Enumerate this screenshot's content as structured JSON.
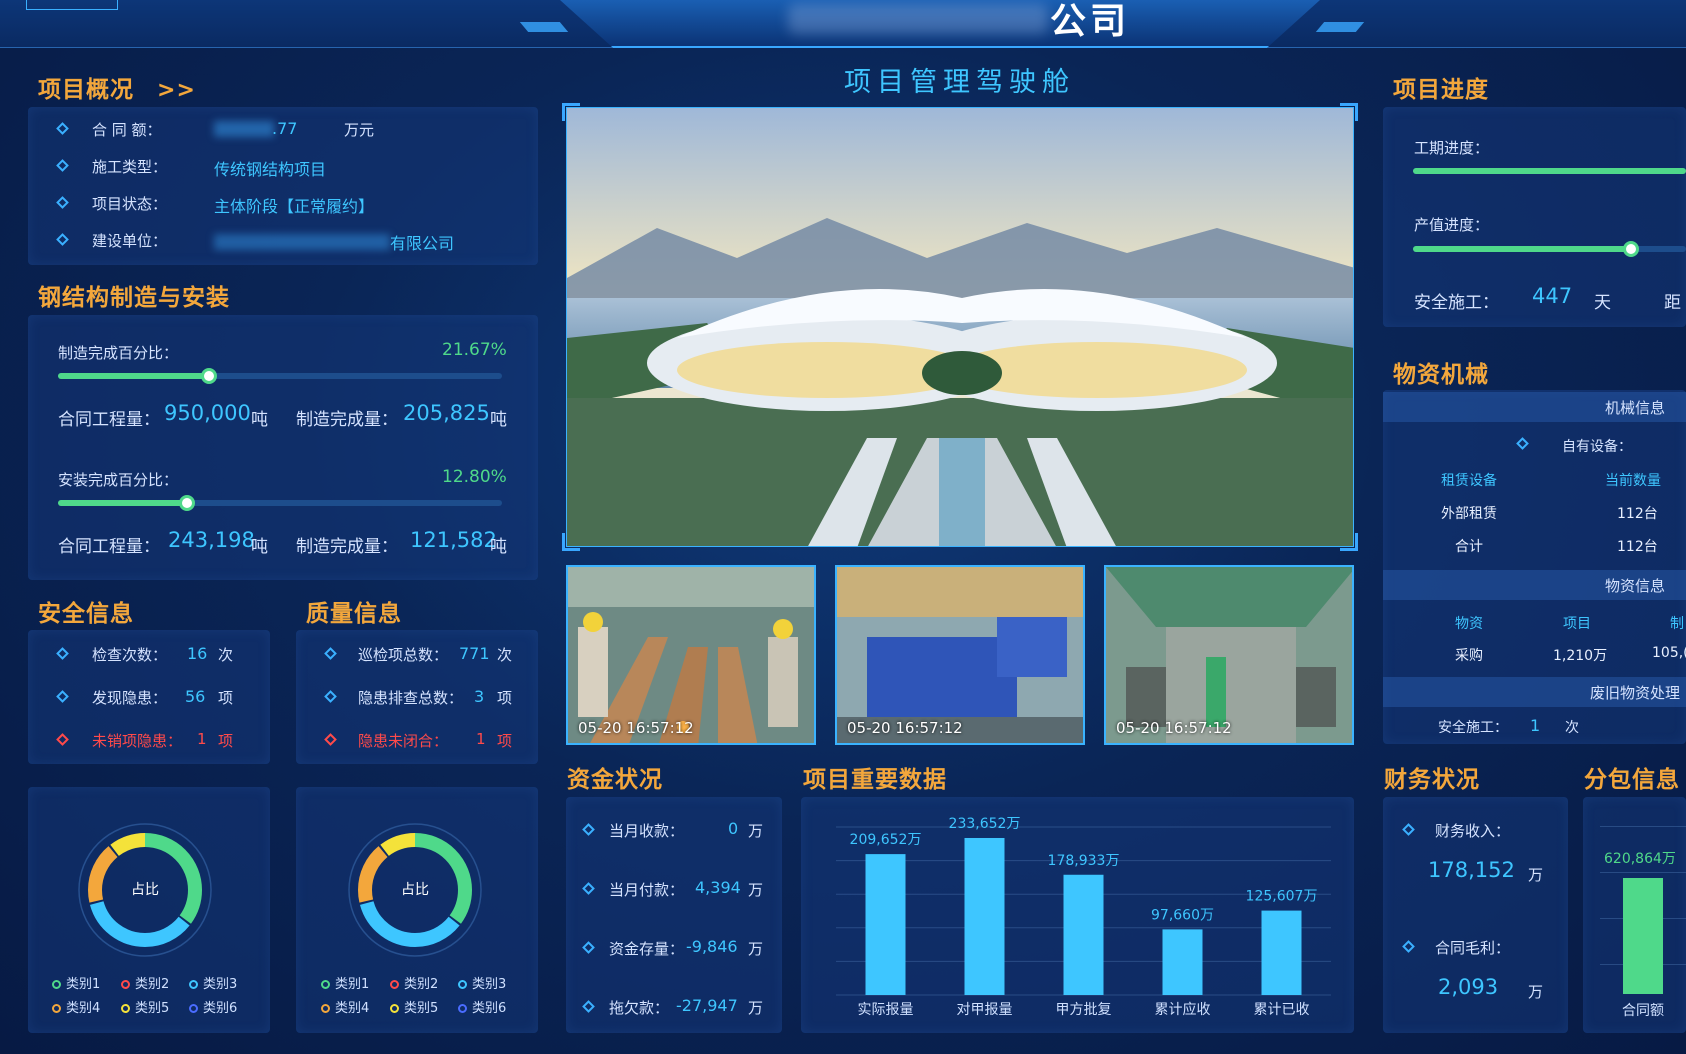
{
  "header": {
    "main_title": "公司",
    "subtitle": "项目管理驾驶舱"
  },
  "overview": {
    "title": "项目概况",
    "arrow": ">>",
    "rows": [
      {
        "label": "合 同 额：",
        "value": ".77",
        "unit": "万元"
      },
      {
        "label": "施工类型：",
        "value": "传统钢结构项目"
      },
      {
        "label": "项目状态：",
        "value": "主体阶段【正常履约】"
      },
      {
        "label": "建设单位：",
        "value": "有限公司"
      }
    ]
  },
  "steel": {
    "title": "钢结构制造与安装",
    "mfg_label": "制造完成百分比：",
    "mfg_pct": "21.67%",
    "mfg_fraction": 0.3412,
    "mfg_contract_label": "合同工程量：",
    "mfg_contract_value": "950,000",
    "mfg_done_label": "制造完成量：",
    "mfg_done_value": "205,825",
    "install_label": "安装完成百分比：",
    "install_pct": "12.80%",
    "install_fraction": 0.2915,
    "install_contract_label": "合同工程量：",
    "install_contract_value": "243,198",
    "install_done_label": "制造完成量：",
    "install_done_value": "121,582",
    "unit": "吨"
  },
  "safety": {
    "title": "安全信息",
    "rows": [
      {
        "label": "检查次数：",
        "value": "16",
        "unit": "次"
      },
      {
        "label": "发现隐患：",
        "value": "56",
        "unit": "项"
      },
      {
        "label": "未销项隐患：",
        "value": "1",
        "unit": "项"
      }
    ]
  },
  "quality": {
    "title": "质量信息",
    "rows": [
      {
        "label": "巡检项总数：",
        "value": "771",
        "unit": "次"
      },
      {
        "label": "隐患排查总数：",
        "value": "3",
        "unit": "项"
      },
      {
        "label": "隐患未闭合：",
        "value": "1",
        "unit": "项"
      }
    ]
  },
  "donut": {
    "center": "占比",
    "legend": [
      "类别1",
      "类别2",
      "类别3",
      "类别4",
      "类别5",
      "类别6"
    ]
  },
  "media": {
    "thumbs": [
      "05-20  16:57:12",
      "05-20  16:57:12",
      "05-20  16:57:12"
    ]
  },
  "funds": {
    "title": "资金状况",
    "rows": [
      {
        "label": "当月收款：",
        "value": "0",
        "unit": "万"
      },
      {
        "label": "当月付款：",
        "value": "4,394",
        "unit": "万"
      },
      {
        "label": "资金存量：",
        "value": "-9,846",
        "unit": "万"
      },
      {
        "label": "拖欠款：",
        "value": "-27,947",
        "unit": "万"
      }
    ]
  },
  "keydata": {
    "title": "项目重要数据"
  },
  "chart_data": {
    "type": "bar",
    "categories": [
      "实际报量",
      "对甲报量",
      "甲方批复",
      "累计应收",
      "累计已收"
    ],
    "values": [
      209652,
      233652,
      178933,
      97660,
      125607
    ],
    "labels": [
      "209,652万",
      "233,652万",
      "178,933万",
      "97,660万",
      "125,607万"
    ],
    "ylim": [
      0,
      250000
    ],
    "color": "#3ec6ff"
  },
  "progress": {
    "title": "项目进度",
    "schedule_label": "工期进度：",
    "output_label": "产值进度：",
    "output_fraction": 0.8,
    "safe_label": "安全施工：",
    "safe_value": "447",
    "safe_unit": "天",
    "extra": "距"
  },
  "materials": {
    "title": "物资机械",
    "machine_header": "机械信息",
    "own_label": "自有设备：",
    "cols": [
      "租赁设备",
      "当前数量"
    ],
    "rows": [
      [
        "外部租赁",
        "112台"
      ],
      [
        "合计",
        "112台"
      ]
    ],
    "material_header": "物资信息",
    "mat_cols": [
      "物资",
      "项目",
      "制"
    ],
    "mat_rows": [
      [
        "采购",
        "1,210万",
        "105,("
      ]
    ],
    "waste_header": "废旧物资处理",
    "waste_label": "安全施工：",
    "waste_value": "1",
    "waste_unit": "次"
  },
  "finance": {
    "title": "财务状况",
    "income_label": "财务收入：",
    "income_value": "178,152",
    "income_unit": "万",
    "profit_label": "合同毛利：",
    "profit_value": "2,093",
    "profit_unit": "万"
  },
  "subcontract": {
    "title": "分包信息",
    "bar_label": "620,864万",
    "category": "合同额"
  }
}
